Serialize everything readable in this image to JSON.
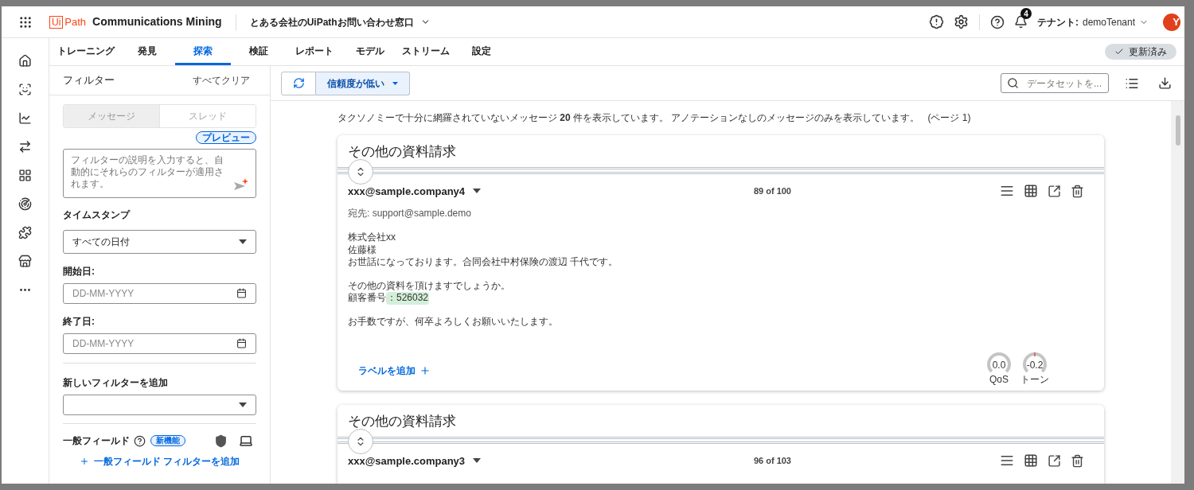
{
  "header": {
    "logo_mark": "Ui",
    "logo_text": "Path",
    "product": "Communications Mining",
    "dataset": "とある会社のUiPathお問い合わせ窓口",
    "notification_count": "4",
    "tenant_label": "テナント:",
    "tenant": "demoTenant",
    "avatar_letter": "Y"
  },
  "tabs": [
    {
      "label": "トレーニング",
      "selected": false
    },
    {
      "label": "発見",
      "selected": false
    },
    {
      "label": "探索",
      "selected": true
    },
    {
      "label": "検証",
      "selected": false
    },
    {
      "label": "レポート",
      "selected": false
    },
    {
      "label": "モデル",
      "selected": false
    },
    {
      "label": "ストリーム",
      "selected": false
    },
    {
      "label": "設定",
      "selected": false
    }
  ],
  "status_chip": "更新済み",
  "filter_panel": {
    "title": "フィルター",
    "clear": "すべてクリア",
    "segments": [
      {
        "label": "メッセージ",
        "selected": true
      },
      {
        "label": "スレッド",
        "selected": false
      }
    ],
    "preview_badge": "プレビュー",
    "describe_placeholder": "フィルターの説明を入力すると、自動的にそれらのフィルターが適用されます。",
    "timestamp_label": "タイムスタンプ",
    "timestamp_value": "すべての日付",
    "start_label": "開始日:",
    "start_placeholder": "DD-MM-YYYY",
    "end_label": "終了日:",
    "end_placeholder": "DD-MM-YYYY",
    "new_filter_label": "新しいフィルターを追加",
    "general_fields_label": "一般フィールド",
    "new_badge": "新機能",
    "add_general_field": "一般フィールド フィルターを追加"
  },
  "toolbar": {
    "filter_chip": "信頼度が低い",
    "search_placeholder": "データセットを..."
  },
  "summary": "タクソノミーで十分に網羅されていないメッセージ **20** 件を表示しています。 アノテーションなしのメッセージのみを表示しています。",
  "page": "(ページ 1)",
  "cards": [
    {
      "title": "その他の資料請求",
      "sender": "xxx@sample.company4",
      "count": "89 of 100",
      "to": "宛先: support@sample.demo",
      "paragraphs": [
        [
          {
            "text": "株式会社xx"
          },
          {
            "text": "佐藤様"
          },
          {
            "text": "お世話になっております。合同会社中村保険の渡辺 千代です。"
          }
        ],
        [
          {
            "text": "その他の資料を頂けますでしょうか。"
          },
          {
            "text": "顧客番号",
            "highlight": "：526032"
          }
        ],
        [
          {
            "text": "お手数ですが、何卒よろしくお願いいたします。"
          }
        ]
      ],
      "add_label": "ラベルを追加",
      "gauges": [
        {
          "value": "0.0",
          "label": "QoS",
          "marker": false
        },
        {
          "value": "-0.2",
          "label": "トーン",
          "marker": true
        }
      ]
    },
    {
      "title": "その他の資料請求",
      "sender": "xxx@sample.company3",
      "count": "96 of 103"
    }
  ]
}
